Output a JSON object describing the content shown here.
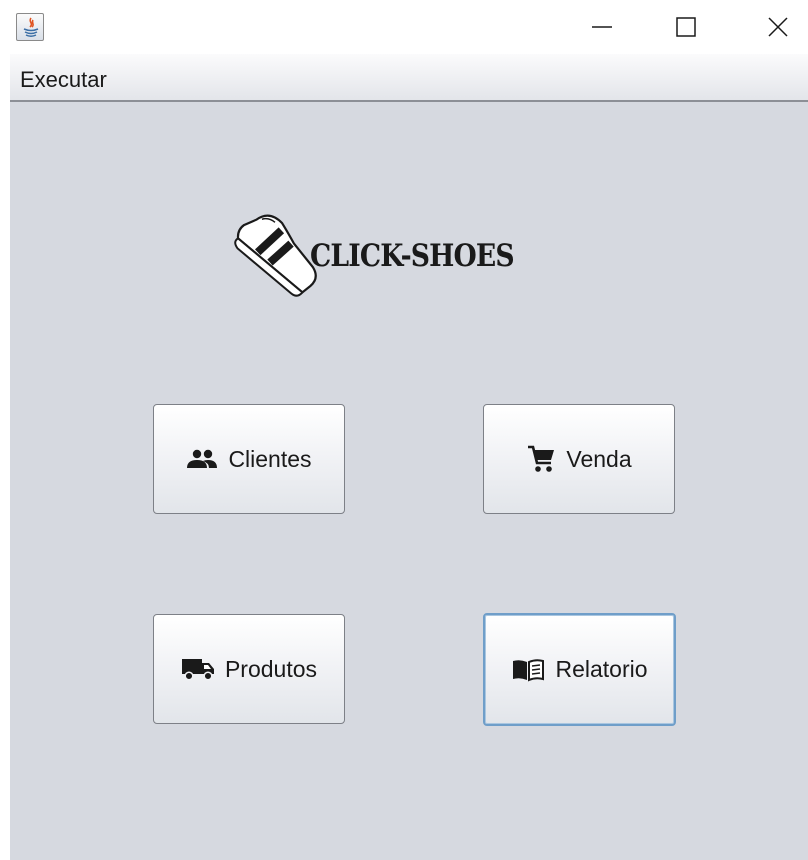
{
  "window": {
    "app_icon": "java-icon",
    "controls": {
      "minimize_icon": "minimize-icon",
      "maximize_icon": "maximize-icon",
      "close_icon": "close-icon"
    }
  },
  "menubar": {
    "items": [
      {
        "label": "Executar"
      }
    ]
  },
  "logo": {
    "text": "CLICK-SHOES",
    "icon": "sneaker-icon"
  },
  "buttons": [
    {
      "label": "Clientes",
      "icon": "people-icon"
    },
    {
      "label": "Venda",
      "icon": "cart-icon"
    },
    {
      "label": "Produtos",
      "icon": "truck-icon"
    },
    {
      "label": "Relatorio",
      "icon": "book-icon",
      "focused": true
    }
  ],
  "colors": {
    "background": "#d6d9e0",
    "focus_border": "#6f9ec9",
    "icon": "#1a1a1a"
  }
}
